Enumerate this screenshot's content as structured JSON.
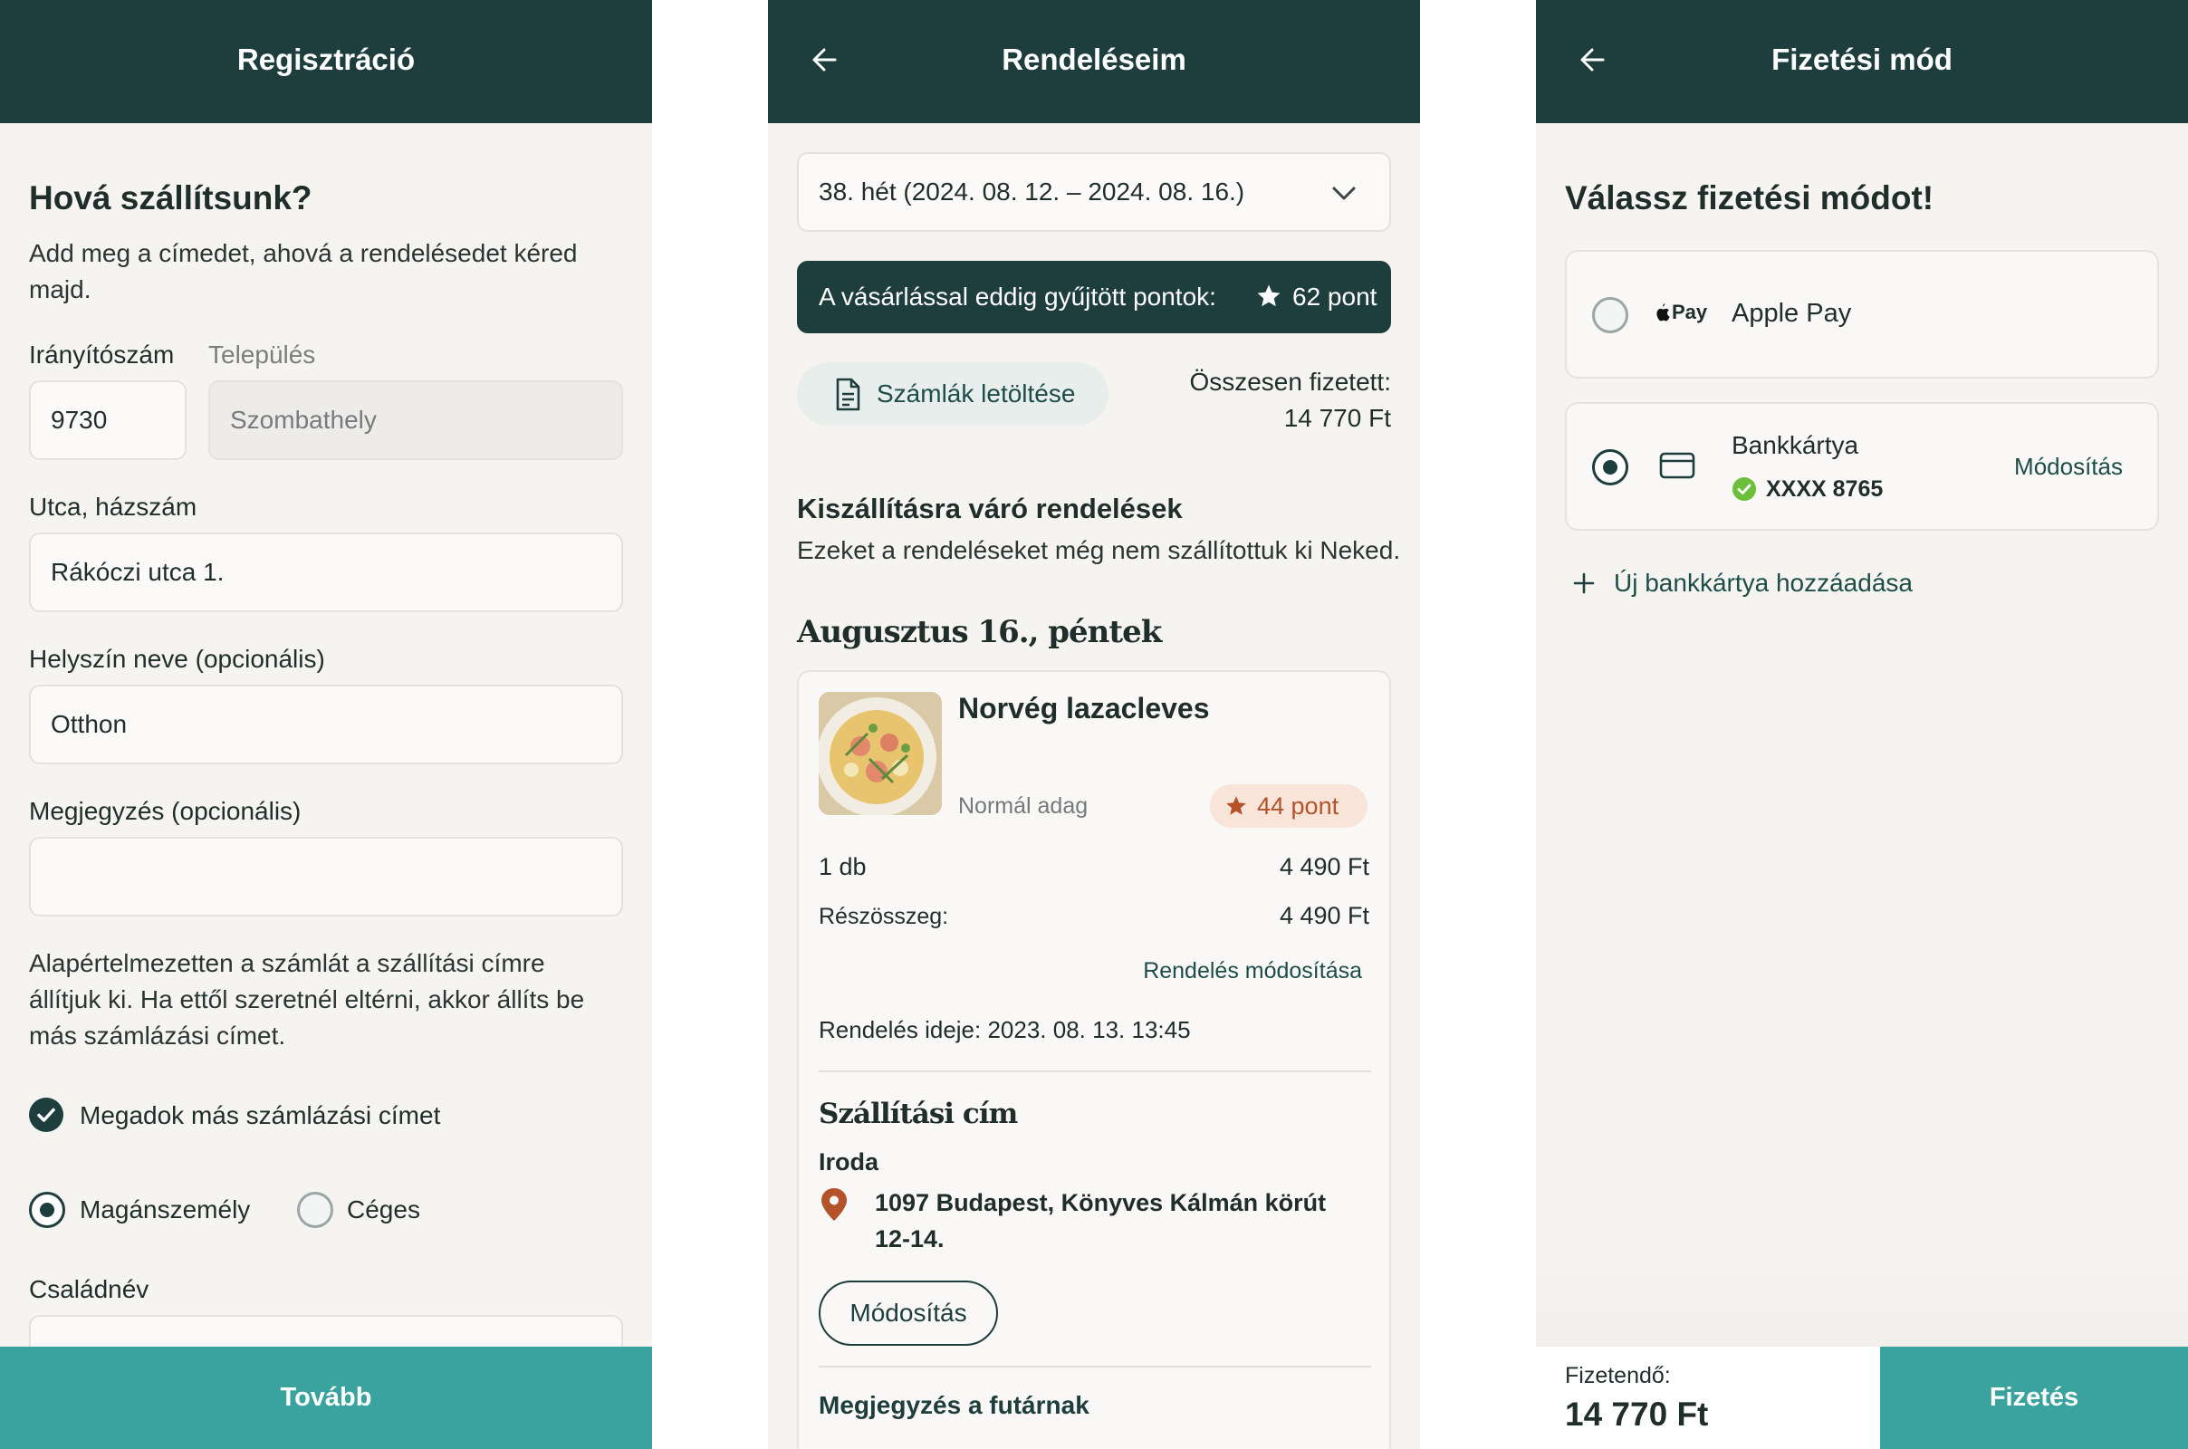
{
  "registration": {
    "title": "Regisztráció",
    "heading": "Hová szállítsunk?",
    "intro": "Add meg a címedet, ahová a rendelésedet kéred majd.",
    "zip_label": "Irányítószám",
    "zip_value": "9730",
    "city_label": "Település",
    "city_value": "Szombathely",
    "street_label": "Utca, házszám",
    "street_value": "Rákóczi utca 1.",
    "place_label": "Helyszín neve (opcionális)",
    "place_value": "Otthon",
    "note_label": "Megjegyzés (opcionális)",
    "note_value": "",
    "billing_info": "Alapértelmezetten a számlát a szállítási címre állítjuk ki. Ha ettől szeretnél eltérni, akkor állíts be más számlázási címet.",
    "billing_checkbox": "Megadok más számlázási címet",
    "person_label": "Magánszemély",
    "company_label": "Céges",
    "lastname_label": "Családnév",
    "next_button": "Tovább"
  },
  "orders": {
    "title": "Rendeléseim",
    "week_select": "38. hét (2024. 08. 12. – 2024. 08. 16.)",
    "points_banner": "A vásárlással eddig gyűjtött pontok:",
    "points_value": "62 pont",
    "invoices_button": "Számlák letöltése",
    "total_label": "Összesen fizetett:",
    "total_value": "14 770 Ft",
    "pending_heading": "Kiszállításra váró rendelések",
    "pending_sub": "Ezeket a rendeléseket még nem szállítottuk ki Neked.",
    "day_heading": "Augusztus 16., péntek",
    "item_name": "Norvég lazacleves",
    "item_portion": "Normál adag",
    "item_points": "44 pont",
    "qty_label": "1 db",
    "qty_price": "4 490 Ft",
    "subtotal_label": "Részösszeg:",
    "subtotal_value": "4 490 Ft",
    "modify_order_link": "Rendelés módosítása",
    "order_time": "Rendelés ideje: 2023. 08. 13. 13:45",
    "shipping_heading": "Szállítási cím",
    "shipping_place": "Iroda",
    "shipping_address": "1097 Budapest, Könyves Kálmán körút 12-14.",
    "shipping_modify": "Módosítás",
    "courier_note_heading": "Megjegyzés a futárnak"
  },
  "payment": {
    "title": "Fizetési mód",
    "heading": "Válassz fizetési módot!",
    "applepay_logo": "Pay",
    "applepay_label": "Apple Pay",
    "card_label": "Bankkártya",
    "card_number": "XXXX 8765",
    "card_modify": "Módosítás",
    "add_card": "Új bankkártya hozzáadása",
    "payable_label": "Fizetendő:",
    "payable_value": "14 770 Ft",
    "pay_button": "Fizetés"
  },
  "colors": {
    "header": "#1e3d3d",
    "accent_teal": "#3aa39d",
    "points_orange": "#b4532a",
    "success_green": "#6cbf3a"
  }
}
